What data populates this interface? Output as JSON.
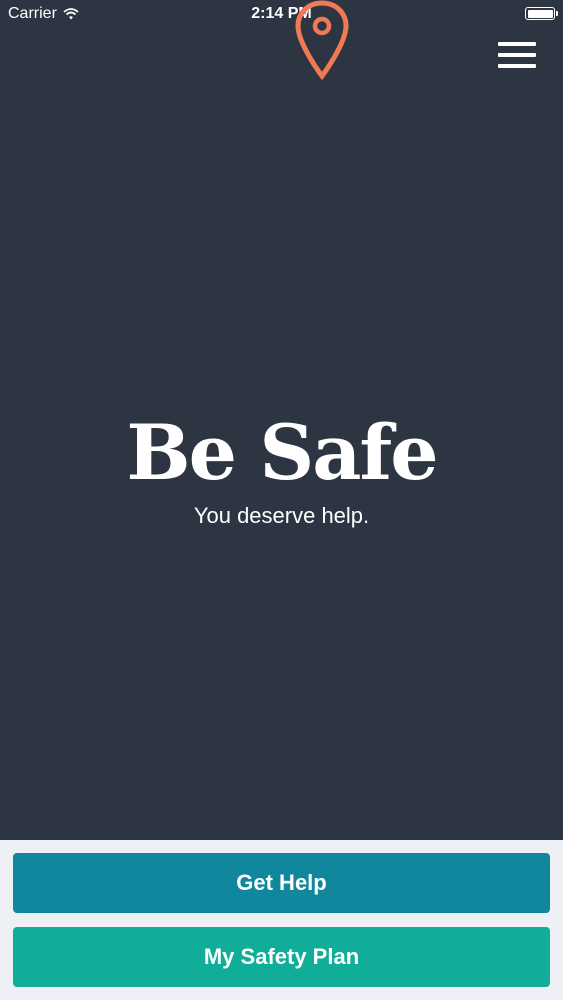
{
  "status_bar": {
    "carrier": "Carrier",
    "time": "2:14 PM",
    "wifi_icon": "wifi-icon",
    "battery_icon": "battery-icon"
  },
  "header": {
    "menu_icon": "hamburger-menu-icon"
  },
  "hero": {
    "brand_name": "Be Safe",
    "tagline": "You deserve help.",
    "logo_icon": "location-pin-icon"
  },
  "actions": {
    "get_help_label": "Get Help",
    "safety_plan_label": "My Safety Plan"
  },
  "colors": {
    "background": "#2d3542",
    "accent_pin": "#ef7a53",
    "get_help_button": "#10879d",
    "safety_plan_button": "#10ae98",
    "footer_background": "#edf0f4"
  }
}
